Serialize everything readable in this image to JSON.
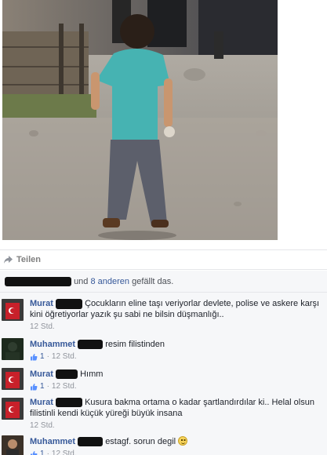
{
  "post": {
    "share_label": "Teilen",
    "likes": {
      "connector": "und",
      "others_count": "8 anderen",
      "suffix": "gefällt das."
    }
  },
  "comments": [
    {
      "author": "Murat",
      "text": "Çocukların eline taşı veriyorlar devlete, polise ve askere karşı kini öğretiyorlar yazık şu sabi ne bilsin düşmanlığı..",
      "time": "12 Std.",
      "likes": ""
    },
    {
      "author": "Muhammet",
      "text": "resim filistinden",
      "time": "12 Std.",
      "likes": "1"
    },
    {
      "author": "Murat",
      "text": "Hımm",
      "time": "12 Std.",
      "likes": "1"
    },
    {
      "author": "Murat",
      "text": "Kusura bakma ortama o kadar şartlandırdılar ki.. Helal olsun filistinli kendi küçük yüreği büyük insana",
      "time": "12 Std.",
      "likes": ""
    },
    {
      "author": "Muhammet",
      "text": "estagf. sorun degil",
      "time": "12 Std.",
      "likes": "1"
    }
  ],
  "colors": {
    "link": "#365899",
    "meta": "#90949c",
    "panel": "#f6f7f9"
  },
  "icons": {
    "share": "share-arrow-icon",
    "like": "thumbs-up-icon",
    "smile": "smiley-emoji-icon"
  }
}
